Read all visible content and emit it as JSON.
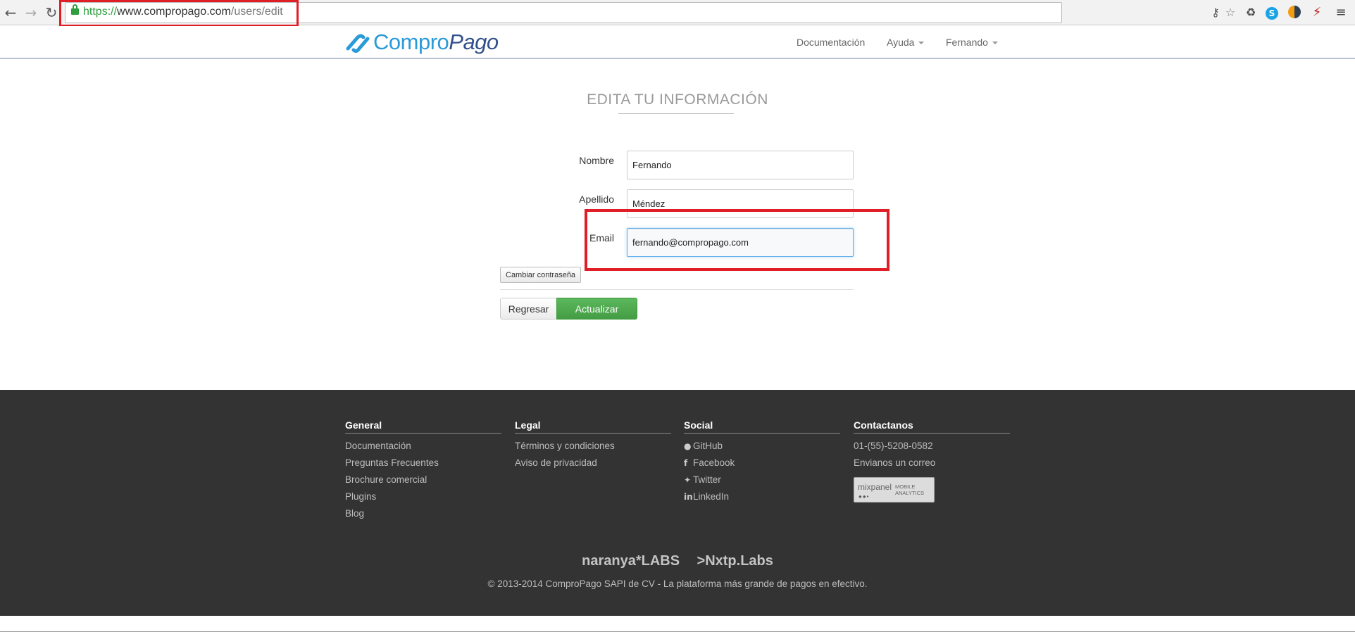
{
  "browser": {
    "url_scheme": "https://",
    "url_host": "www.compropago.com",
    "url_path": "/users/edit",
    "icons": [
      "back-arrow-icon",
      "forward-arrow-icon",
      "reload-icon",
      "lock-icon",
      "key-icon",
      "star-icon",
      "recycle-icon",
      "skype-icon",
      "extension-icon",
      "extension-icon-2",
      "menu-icon"
    ]
  },
  "header": {
    "logo_part1": "Compro",
    "logo_part2": "Pago",
    "nav": {
      "docs": "Documentación",
      "help": "Ayuda",
      "user": "Fernando"
    }
  },
  "form": {
    "title": "EDITA TU INFORMACIÓN",
    "fields": {
      "nombre_label": "Nombre",
      "nombre_value": "Fernando",
      "apellido_label": "Apellido",
      "apellido_value": "Méndez",
      "email_label": "Email",
      "email_value": "fernando@compropago.com"
    },
    "change_password": "Cambiar contraseña",
    "back": "Regresar",
    "update": "Actualizar"
  },
  "footer": {
    "general": {
      "title": "General",
      "links": [
        "Documentación",
        "Preguntas Frecuentes",
        "Brochure comercial",
        "Plugins",
        "Blog"
      ]
    },
    "legal": {
      "title": "Legal",
      "links": [
        "Términos y condiciones",
        "Aviso de privacidad"
      ]
    },
    "social": {
      "title": "Social",
      "links": [
        "GitHub",
        "Facebook",
        "Twitter",
        "LinkedIn"
      ]
    },
    "contact": {
      "title": "Contactanos",
      "phone": "01-(55)-5208-0582",
      "email": "Envianos un correo",
      "mixpanel_name": "mixpanel",
      "mixpanel_tag": "MOBILE ANALYTICS"
    },
    "partner1": "naranya*LABS",
    "partner2": ">Nxtp.Labs",
    "copyright": "© 2013-2014 ComproPago SAPI de CV - La plataforma más grande de pagos en efectivo."
  },
  "colors": {
    "brand_blue": "#2a9ad8",
    "brand_navy": "#33508c",
    "update_green": "#5cb85c",
    "highlight_red": "#e01e26",
    "footer_bg": "#333333"
  }
}
